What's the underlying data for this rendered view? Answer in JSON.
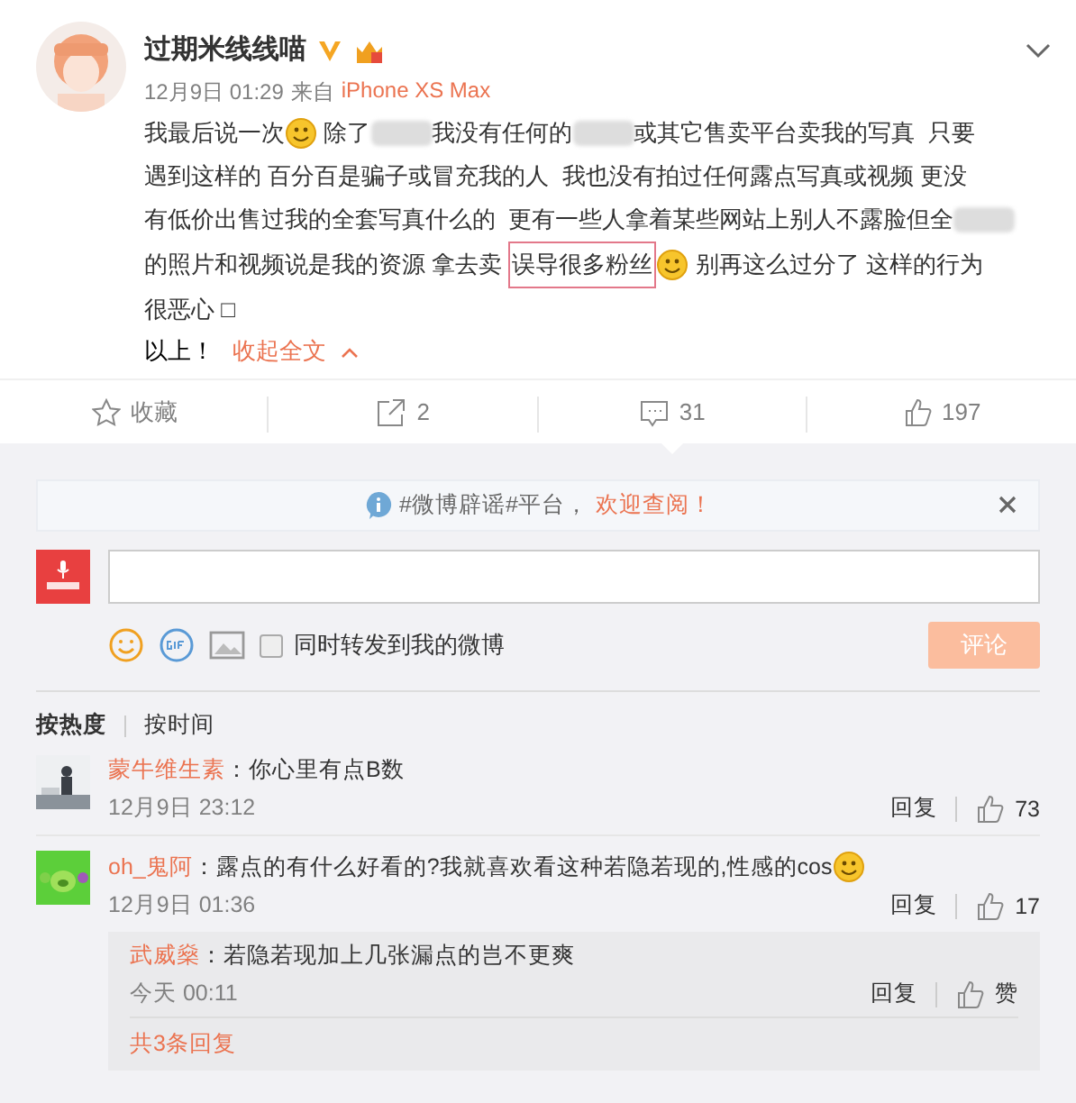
{
  "post": {
    "author": "过期米线线喵",
    "time": "12月9日 01:29",
    "source_label": "来自",
    "source": "iPhone XS Max",
    "lines": [
      [
        {
          "kind": "text",
          "text": "我最后说一次"
        },
        {
          "kind": "emoji"
        },
        {
          "kind": "text",
          "text": " 除了"
        },
        {
          "kind": "blur"
        },
        {
          "kind": "text",
          "text": "我没有任何的"
        },
        {
          "kind": "blur"
        },
        {
          "kind": "text",
          "text": "或其它售卖平台卖我的写真  只要"
        }
      ],
      [
        {
          "kind": "text",
          "text": "遇到这样的 百分百是骗子或冒充我的人  我也没有拍过任何露点写真或视频 更没"
        }
      ],
      [
        {
          "kind": "text",
          "text": "有低价出售过我的全套写真什么的  更有一些人拿着某些网站上别人不露脸但全"
        },
        {
          "kind": "blur"
        }
      ],
      [
        {
          "kind": "text",
          "text": "的照片和视频说是我的资源 拿去卖 "
        },
        {
          "kind": "highlight",
          "text": "误导很多粉丝"
        },
        {
          "kind": "emoji"
        },
        {
          "kind": "text",
          "text": " 别再这么过分了 这样的行为"
        }
      ],
      [
        {
          "kind": "text",
          "text": "很恶心 □"
        }
      ]
    ],
    "footer": "以上！",
    "collapse": "收起全文"
  },
  "actions": [
    {
      "kind": "favorite",
      "label": "收藏",
      "selected": false
    },
    {
      "kind": "repost",
      "label": "2",
      "selected": false
    },
    {
      "kind": "comment",
      "label": "31",
      "selected": true
    },
    {
      "kind": "like",
      "label": "197",
      "selected": false
    }
  ],
  "notice": {
    "text": "#微博辟谣#平台，",
    "link": "欢迎查阅！"
  },
  "composer": {
    "repost_label": "同时转发到我的微博",
    "repost_checked": false,
    "submit": "评论",
    "submit_disabled": true
  },
  "sort_tabs": [
    {
      "label": "按热度",
      "selected": true
    },
    {
      "label": "按时间",
      "selected": false
    }
  ],
  "comments": [
    {
      "author": "蒙牛维生素",
      "text": "：你心里有点B数",
      "emoji": false,
      "time": "12月9日 23:12",
      "reply": "回复",
      "likes": "73"
    },
    {
      "author": "oh_鬼阿",
      "text": "：露点的有什么好看的?我就喜欢看这种若隐若现的,性感的cos",
      "emoji": true,
      "time": "12月9日 01:36",
      "reply": "回复",
      "likes": "17",
      "replies": [
        {
          "author": "武威燊",
          "text": "：若隐若现加上几张漏点的岂不更爽",
          "time": "今天 00:11",
          "reply": "回复",
          "likes": "赞"
        }
      ],
      "more": "共3条回复"
    }
  ]
}
